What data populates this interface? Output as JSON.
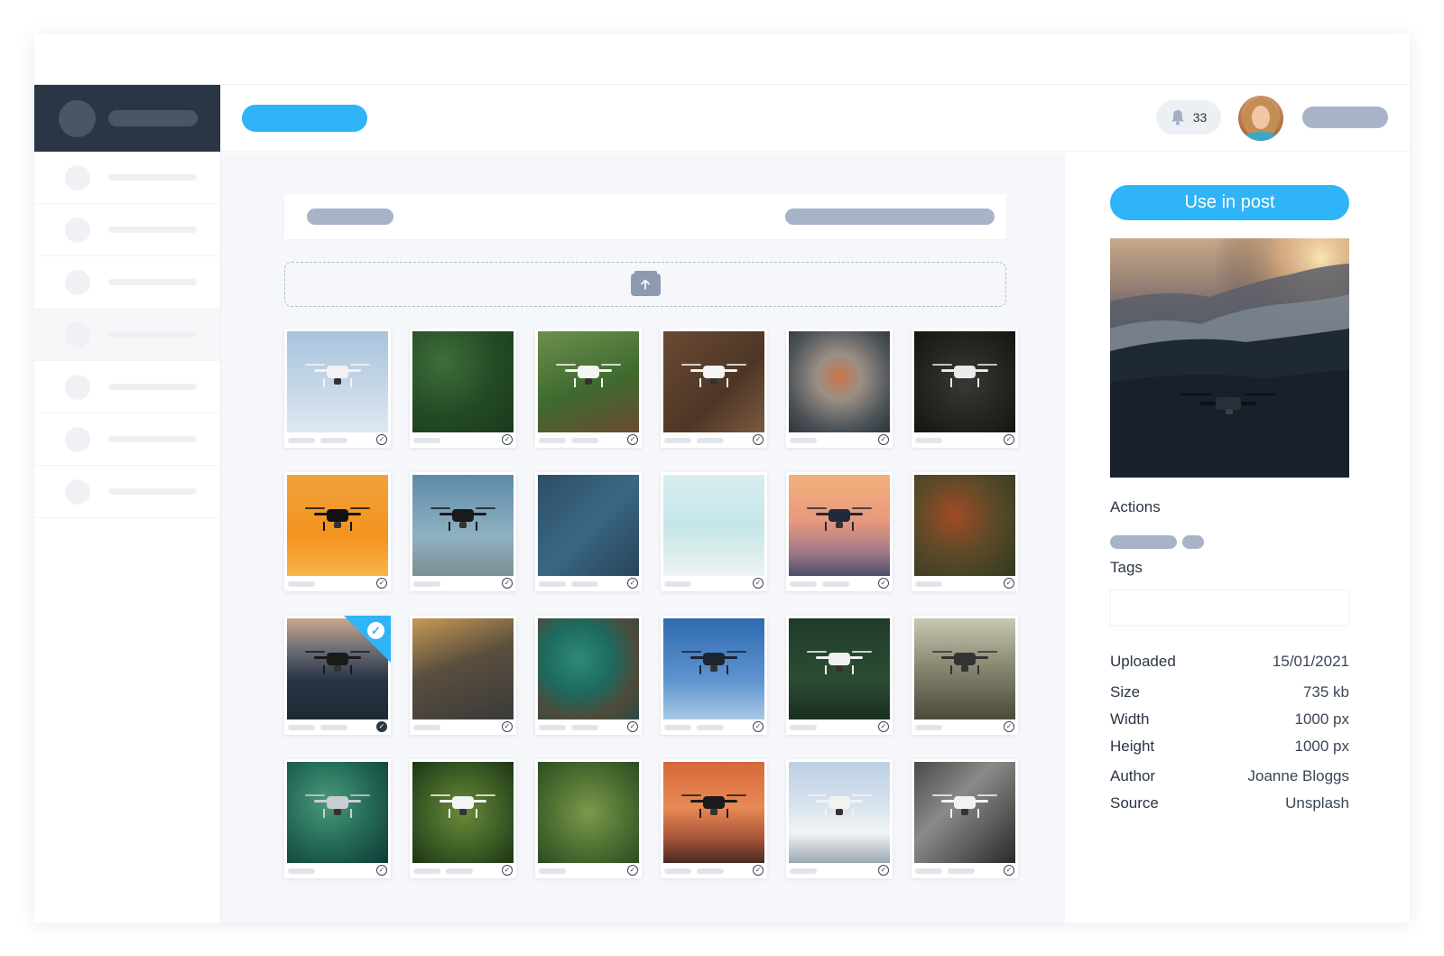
{
  "header": {
    "notifications_count": "33"
  },
  "sidebar": {
    "items": [
      "",
      "",
      "",
      "",
      "",
      "",
      ""
    ]
  },
  "details": {
    "use_button": "Use in post",
    "actions_label": "Actions",
    "tags_label": "Tags",
    "tags_value": "",
    "rows": [
      {
        "key": "Uploaded",
        "value": "15/01/2021"
      },
      {
        "key": "Size",
        "value": "735 kb"
      },
      {
        "key": "Width",
        "value": "1000 px"
      },
      {
        "key": "Height",
        "value": "1000 px"
      },
      {
        "key": "Author",
        "value": "Joanne Bloggs"
      },
      {
        "key": "Source",
        "value": "Unsplash"
      }
    ]
  },
  "gallery": {
    "selected_index": 12,
    "images": [
      {
        "subject": "white drone against pale blue sky",
        "bg": "linear-gradient(180deg,#a8c3dd 0%,#c8d9e8 60%,#dfe8f0 100%)",
        "drone": "#f2f2f2"
      },
      {
        "subject": "aerial winding road through forest",
        "bg": "radial-gradient(circle at 30% 30%,#3f6e3a 0%,#244a25 55%,#1a3a1c 100%)",
        "drone": ""
      },
      {
        "subject": "hands holding white drone",
        "bg": "linear-gradient(160deg,#6d8f4d 0%,#3f6a2e 55%,#6b4a33 100%)",
        "drone": "#f4f4f4"
      },
      {
        "subject": "drone and cameras on wooden table",
        "bg": "linear-gradient(135deg,#6a4a33 0%,#4e3626 60%,#7a5a40 100%)",
        "drone": "#f4f4f4"
      },
      {
        "subject": "aerial view of city intersection",
        "bg": "radial-gradient(circle at 50% 45%,#c9754a 0%,#9a8f86 30%,#4c5358 70%,#2e3438 100%)",
        "drone": ""
      },
      {
        "subject": "white drone with dark bokeh background",
        "bg": "radial-gradient(circle at 50% 50%,#3a3a33 0%,#1f1f1b 70%,#141412 100%)",
        "drone": "#eaeaea"
      },
      {
        "subject": "drone silhouette at orange sunset",
        "bg": "linear-gradient(180deg,#f0a23a 0%,#f39320 60%,#f7b44a 100%)",
        "drone": "#111111"
      },
      {
        "subject": "drone over sea at dusk",
        "bg": "linear-gradient(180deg,#5c8ba8 0%,#8fb1c2 60%,#7c8f95 100%)",
        "drone": "#1a1a1a"
      },
      {
        "subject": "red bridge over ocean from above",
        "bg": "linear-gradient(135deg,#2c4e66 0%,#3b6784 50%,#284459 100%)",
        "drone": ""
      },
      {
        "subject": "modern building facade",
        "bg": "linear-gradient(180deg,#d7eef0 0%,#c5e6e8 50%,#eef2f2 100%)",
        "drone": ""
      },
      {
        "subject": "drone in sunset sky over hills",
        "bg": "linear-gradient(180deg,#f3b07a 0%,#e89a7d 45%,#a77a88 75%,#4a4e6a 100%)",
        "drone": "#1f2a3a"
      },
      {
        "subject": "aerial road through autumn forest",
        "bg": "radial-gradient(circle at 40% 40%,#a24a26 0%,#5e4a28 45%,#2f3a22 100%)",
        "drone": ""
      },
      {
        "subject": "drone flying over mountain at dusk",
        "bg": "linear-gradient(180deg,#c9a78a 0%,#6f6f78 30%,#2a3544 60%,#1e2833 100%)",
        "drone": "#1a1a1a"
      },
      {
        "subject": "hands holding drone remote controller",
        "bg": "linear-gradient(160deg,#c79a55 0%,#5a4e3e 45%,#3a3a3a 100%)",
        "drone": ""
      },
      {
        "subject": "aerial coastline with rocks",
        "bg": "radial-gradient(circle at 40% 40%,#2d8a78 0%,#1d6a5f 40%,#4e4a3a 70%,#2a4a44 100%)",
        "drone": ""
      },
      {
        "subject": "dark drone against blue sky",
        "bg": "linear-gradient(180deg,#2f6ab0 0%,#5d93cf 60%,#a8c8e6 100%)",
        "drone": "#1c2430"
      },
      {
        "subject": "white drone over green forest",
        "bg": "linear-gradient(180deg,#1f3b2a 0%,#2c4d33 60%,#1a2e20 100%)",
        "drone": "#f0f0f0"
      },
      {
        "subject": "misty forest with drone",
        "bg": "linear-gradient(180deg,#c8c9b4 0%,#8b8a74 45%,#4b4a3a 100%)",
        "drone": "#333333"
      },
      {
        "subject": "grey drone on teal green background",
        "bg": "radial-gradient(circle at 40% 40%,#4a9a7a 0%,#246a58 50%,#0f3a34 100%)",
        "drone": "#c9ced4"
      },
      {
        "subject": "white drone among green leaves",
        "bg": "radial-gradient(circle at 50% 50%,#6a8a3a 0%,#3a5a24 60%,#1d3416 100%)",
        "drone": "#f4f4f4"
      },
      {
        "subject": "aerial rice terraces",
        "bg": "radial-gradient(circle at 50% 50%,#7a9a4a 0%,#4e6e32 55%,#2e4a22 100%)",
        "drone": ""
      },
      {
        "subject": "drone at orange sunset over sea",
        "bg": "linear-gradient(180deg,#d8673a 0%,#e88a55 45%,#a8553a 75%,#4a2a22 100%)",
        "drone": "#1a1a1a"
      },
      {
        "subject": "drone above clouds and mountains",
        "bg": "linear-gradient(180deg,#bcd0e3 0%,#d9e4ee 45%,#f2f4f6 70%,#9aa8b0 100%)",
        "drone": "#f2f2f2"
      },
      {
        "subject": "white drone indoors",
        "bg": "linear-gradient(135deg,#4a4a4a 0%,#8a8a88 40%,#2a2a2a 100%)",
        "drone": "#f2f2f2"
      }
    ]
  }
}
